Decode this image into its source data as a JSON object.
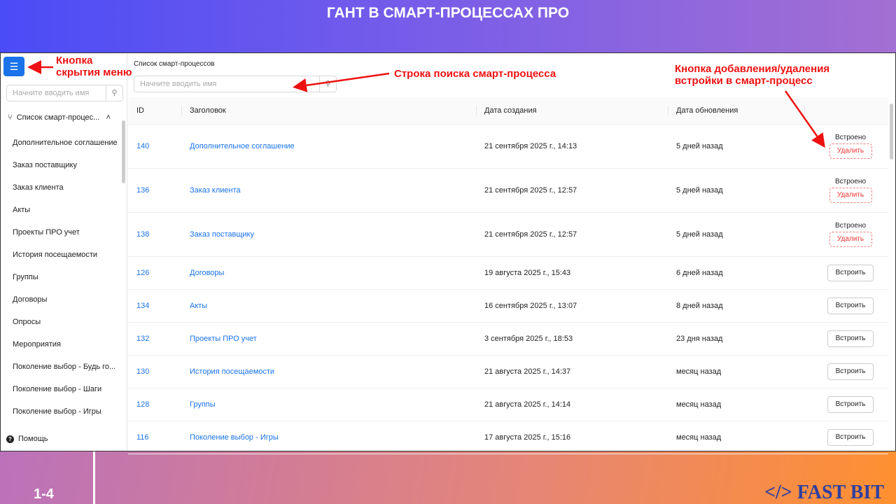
{
  "slide": {
    "title": "ГАНТ В СМАРТ-ПРОЦЕССАХ ПРО",
    "page": "1-4",
    "logo": "</> FAST BIT"
  },
  "annotations": {
    "menu": "Кнопка\nскрытия меню",
    "search": "Строка поиска смарт-процесса",
    "embed": "Кнопка добавления/удаления\nвстройки в смарт-процесс",
    "color": "#e11111"
  },
  "sidebar": {
    "menu_icon": "menu-fold-icon",
    "search_placeholder": "Начните вводить имя",
    "group": "Список смарт-процес...",
    "items": [
      "Дополнительное соглашение",
      "Заказ поставщику",
      "Заказ клиента",
      "Акты",
      "Проекты ПРО учет",
      "История посещаемости",
      "Группы",
      "Договоры",
      "Опросы",
      "Мероприятия",
      "Поколение выбор - Будь го...",
      "Поколение выбор - Шаги",
      "Поколение выбор - Игры"
    ],
    "help": "Помощь"
  },
  "main": {
    "breadcrumb": "Список смарт-процессов",
    "search_placeholder": "Начните вводить имя",
    "columns": [
      "ID",
      "Заголовок",
      "Дата создания",
      "Дата обновления",
      ""
    ],
    "embedded_label": "Встроено",
    "delete_label": "Удалить",
    "embed_label": "Встроить",
    "rows": [
      {
        "id": "140",
        "title": "Дополнительное соглашение",
        "created": "21 сентября 2025 г., 14:13",
        "updated": "5 дней назад",
        "embedded": true
      },
      {
        "id": "136",
        "title": "Заказ клиента",
        "created": "21 сентября 2025 г., 12:57",
        "updated": "5 дней назад",
        "embedded": true
      },
      {
        "id": "138",
        "title": "Заказ поставщику",
        "created": "21 сентября 2025 г., 12:57",
        "updated": "5 дней назад",
        "embedded": true
      },
      {
        "id": "126",
        "title": "Договоры",
        "created": "19 августа 2025 г., 15:43",
        "updated": "6 дней назад",
        "embedded": false
      },
      {
        "id": "134",
        "title": "Акты",
        "created": "16 сентября 2025 г., 13:07",
        "updated": "8 дней назад",
        "embedded": false
      },
      {
        "id": "132",
        "title": "Проекты ПРО учет",
        "created": "3 сентября 2025 г., 18:53",
        "updated": "23 дня назад",
        "embedded": false
      },
      {
        "id": "130",
        "title": "История посещаемости",
        "created": "21 августа 2025 г., 14:37",
        "updated": "месяц назад",
        "embedded": false
      },
      {
        "id": "128",
        "title": "Группы",
        "created": "21 августа 2025 г., 14:14",
        "updated": "месяц назад",
        "embedded": false
      },
      {
        "id": "116",
        "title": "Поколение выбор - Игры",
        "created": "17 августа 2025 г., 15:16",
        "updated": "месяц назад",
        "embedded": false
      }
    ]
  }
}
